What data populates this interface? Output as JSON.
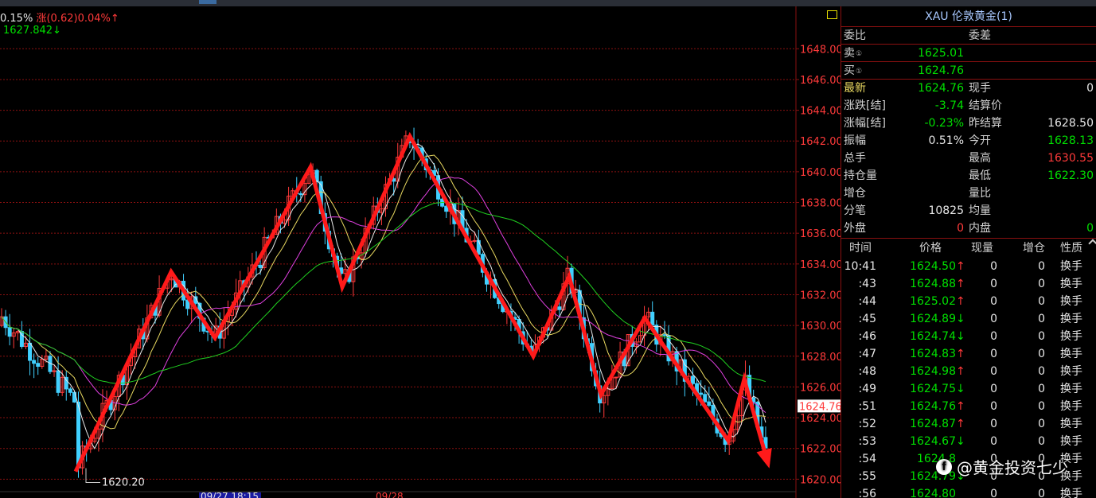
{
  "legend": {
    "change_pct_left": "0.15%",
    "change_label": "涨",
    "change_value": "(0.62)",
    "change_pct": "0.04%",
    "arrow_up": "↑",
    "last_value": "1627.842",
    "arrow_down": "↓"
  },
  "chart_data": {
    "type": "candlestick",
    "ylim": [
      1619.5,
      1650.5
    ],
    "y_ticks": [
      "1648.00",
      "1646.00",
      "1644.00",
      "1642.00",
      "1640.00",
      "1638.00",
      "1636.00",
      "1634.00",
      "1632.00",
      "1630.00",
      "1628.00",
      "1626.00",
      "1624.00",
      "1622.00",
      "1620.00"
    ],
    "y_tick_values": [
      1648,
      1646,
      1644,
      1642,
      1640,
      1638,
      1636,
      1634,
      1632,
      1630,
      1628,
      1626,
      1624,
      1622,
      1620
    ],
    "current_price_label": "1624.76",
    "current_price": 1624.76,
    "min_label": "1620.20",
    "min_value": 1620.2,
    "x_labels": [
      "09/27 18:15",
      "09/28"
    ],
    "x_label_positions": [
      0.25,
      0.47
    ],
    "zigzag": [
      [
        0.095,
        1620.5
      ],
      [
        0.215,
        1633.5
      ],
      [
        0.27,
        1629.2
      ],
      [
        0.39,
        1640.3
      ],
      [
        0.43,
        1632.5
      ],
      [
        0.515,
        1642.3
      ],
      [
        0.67,
        1628
      ],
      [
        0.715,
        1633.2
      ],
      [
        0.755,
        1625.5
      ],
      [
        0.81,
        1630.5
      ],
      [
        0.915,
        1622.5
      ],
      [
        0.935,
        1626.5
      ],
      [
        0.965,
        1621
      ]
    ]
  },
  "panel": {
    "title": "XAU 伦敦黄金(1)",
    "weibi_label": "委比",
    "weicha_label": "委差",
    "sell_label": "卖",
    "sell_price": "1625.01",
    "buy_label": "买",
    "buy_price": "1624.76",
    "circle": "①",
    "stats": [
      {
        "l1": "最新",
        "v1": "1624.76",
        "l2": "现手",
        "v2": "0"
      },
      {
        "l1": "涨跌[结]",
        "v1": "-3.74",
        "l2": "结算价",
        "v2": ""
      },
      {
        "l1": "涨幅[结]",
        "v1": "-0.23%",
        "l2": "昨结算",
        "v2": "1628.50"
      },
      {
        "l1": "振幅",
        "v1": "0.51%",
        "l2": "今开",
        "v2": "1628.13"
      },
      {
        "l1": "总手",
        "v1": "",
        "l2": "最高",
        "v2": "1630.55"
      },
      {
        "l1": "持仓量",
        "v1": "",
        "l2": "最低",
        "v2": "1622.30"
      },
      {
        "l1": "增仓",
        "v1": "",
        "l2": "量比",
        "v2": ""
      },
      {
        "l1": "分笔",
        "v1": "10825",
        "l2": "均量",
        "v2": ""
      },
      {
        "l1": "外盘",
        "v1": "0",
        "l2": "内盘",
        "v2": "0"
      }
    ],
    "tick_headers": {
      "time": "时间",
      "price": "价格",
      "vol": "现量",
      "oi": "增仓",
      "nature": "性质"
    },
    "ticks": [
      {
        "time": "10:41",
        "price": "1624.50",
        "dir": "↑",
        "vol": "0",
        "oi": "0",
        "nature": "换手"
      },
      {
        "time": ":43",
        "price": "1624.88",
        "dir": "↑",
        "vol": "0",
        "oi": "0",
        "nature": "换手"
      },
      {
        "time": ":44",
        "price": "1625.02",
        "dir": "↑",
        "vol": "0",
        "oi": "0",
        "nature": "换手"
      },
      {
        "time": ":45",
        "price": "1624.89",
        "dir": "↓",
        "vol": "0",
        "oi": "0",
        "nature": "换手"
      },
      {
        "time": ":46",
        "price": "1624.74",
        "dir": "↓",
        "vol": "0",
        "oi": "0",
        "nature": "换手"
      },
      {
        "time": ":47",
        "price": "1624.83",
        "dir": "↑",
        "vol": "0",
        "oi": "0",
        "nature": "换手"
      },
      {
        "time": ":48",
        "price": "1624.98",
        "dir": "↑",
        "vol": "0",
        "oi": "0",
        "nature": "换手"
      },
      {
        "time": ":49",
        "price": "1624.75",
        "dir": "↓",
        "vol": "0",
        "oi": "0",
        "nature": "换手"
      },
      {
        "time": ":51",
        "price": "1624.76",
        "dir": "↑",
        "vol": "0",
        "oi": "0",
        "nature": "换手"
      },
      {
        "time": ":52",
        "price": "1624.87",
        "dir": "↑",
        "vol": "0",
        "oi": "0",
        "nature": "换手"
      },
      {
        "time": ":53",
        "price": "1624.67",
        "dir": "↓",
        "vol": "0",
        "oi": "0",
        "nature": "换手"
      },
      {
        "time": ":54",
        "price": "1624.8",
        "dir": "",
        "vol": "0",
        "oi": "0",
        "nature": "换手"
      },
      {
        "time": ":55",
        "price": "1624.79",
        "dir": "↓",
        "vol": "0",
        "oi": "0",
        "nature": "换手"
      },
      {
        "time": ":56",
        "price": "1624.80",
        "dir": "",
        "vol": "0",
        "oi": "0",
        "nature": "换手"
      }
    ]
  },
  "watermark": {
    "logo": "f",
    "text": "@黄金投资七少"
  },
  "colors": {
    "up": "#ff3a3a",
    "down": "#40d0ff",
    "grid": "#8a1010",
    "ma_white": "#e8e8e8",
    "ma_yellow": "#e8d860",
    "ma_magenta": "#e040e0",
    "ma_green": "#20d020"
  }
}
